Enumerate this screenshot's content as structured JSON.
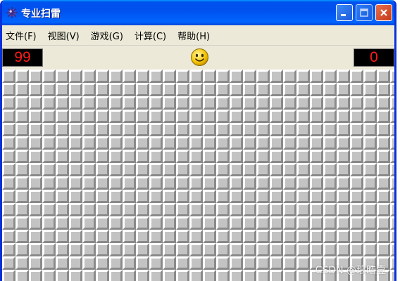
{
  "window": {
    "title": "专业扫雷",
    "icon": "mine-icon"
  },
  "titlebar_buttons": {
    "minimize_icon": "minimize-icon",
    "maximize_icon": "maximize-icon",
    "close_icon": "close-icon"
  },
  "menu": [
    {
      "label": "文件(F)"
    },
    {
      "label": "视图(V)"
    },
    {
      "label": "游戏(G)"
    },
    {
      "label": "计算(C)"
    },
    {
      "label": "帮助(H)"
    }
  ],
  "status": {
    "mines_remaining": "99",
    "timer": "0",
    "face_icon": "smiley-face-icon"
  },
  "board": {
    "columns": 30,
    "rows": 16,
    "cell_state": "unopened"
  },
  "watermark": "CSDN @琅晧壹",
  "colors": {
    "counter_text": "#ff1a1a",
    "counter_bg": "#000000",
    "cell": "#c3c3c3",
    "titlebar": "#0055ea"
  }
}
